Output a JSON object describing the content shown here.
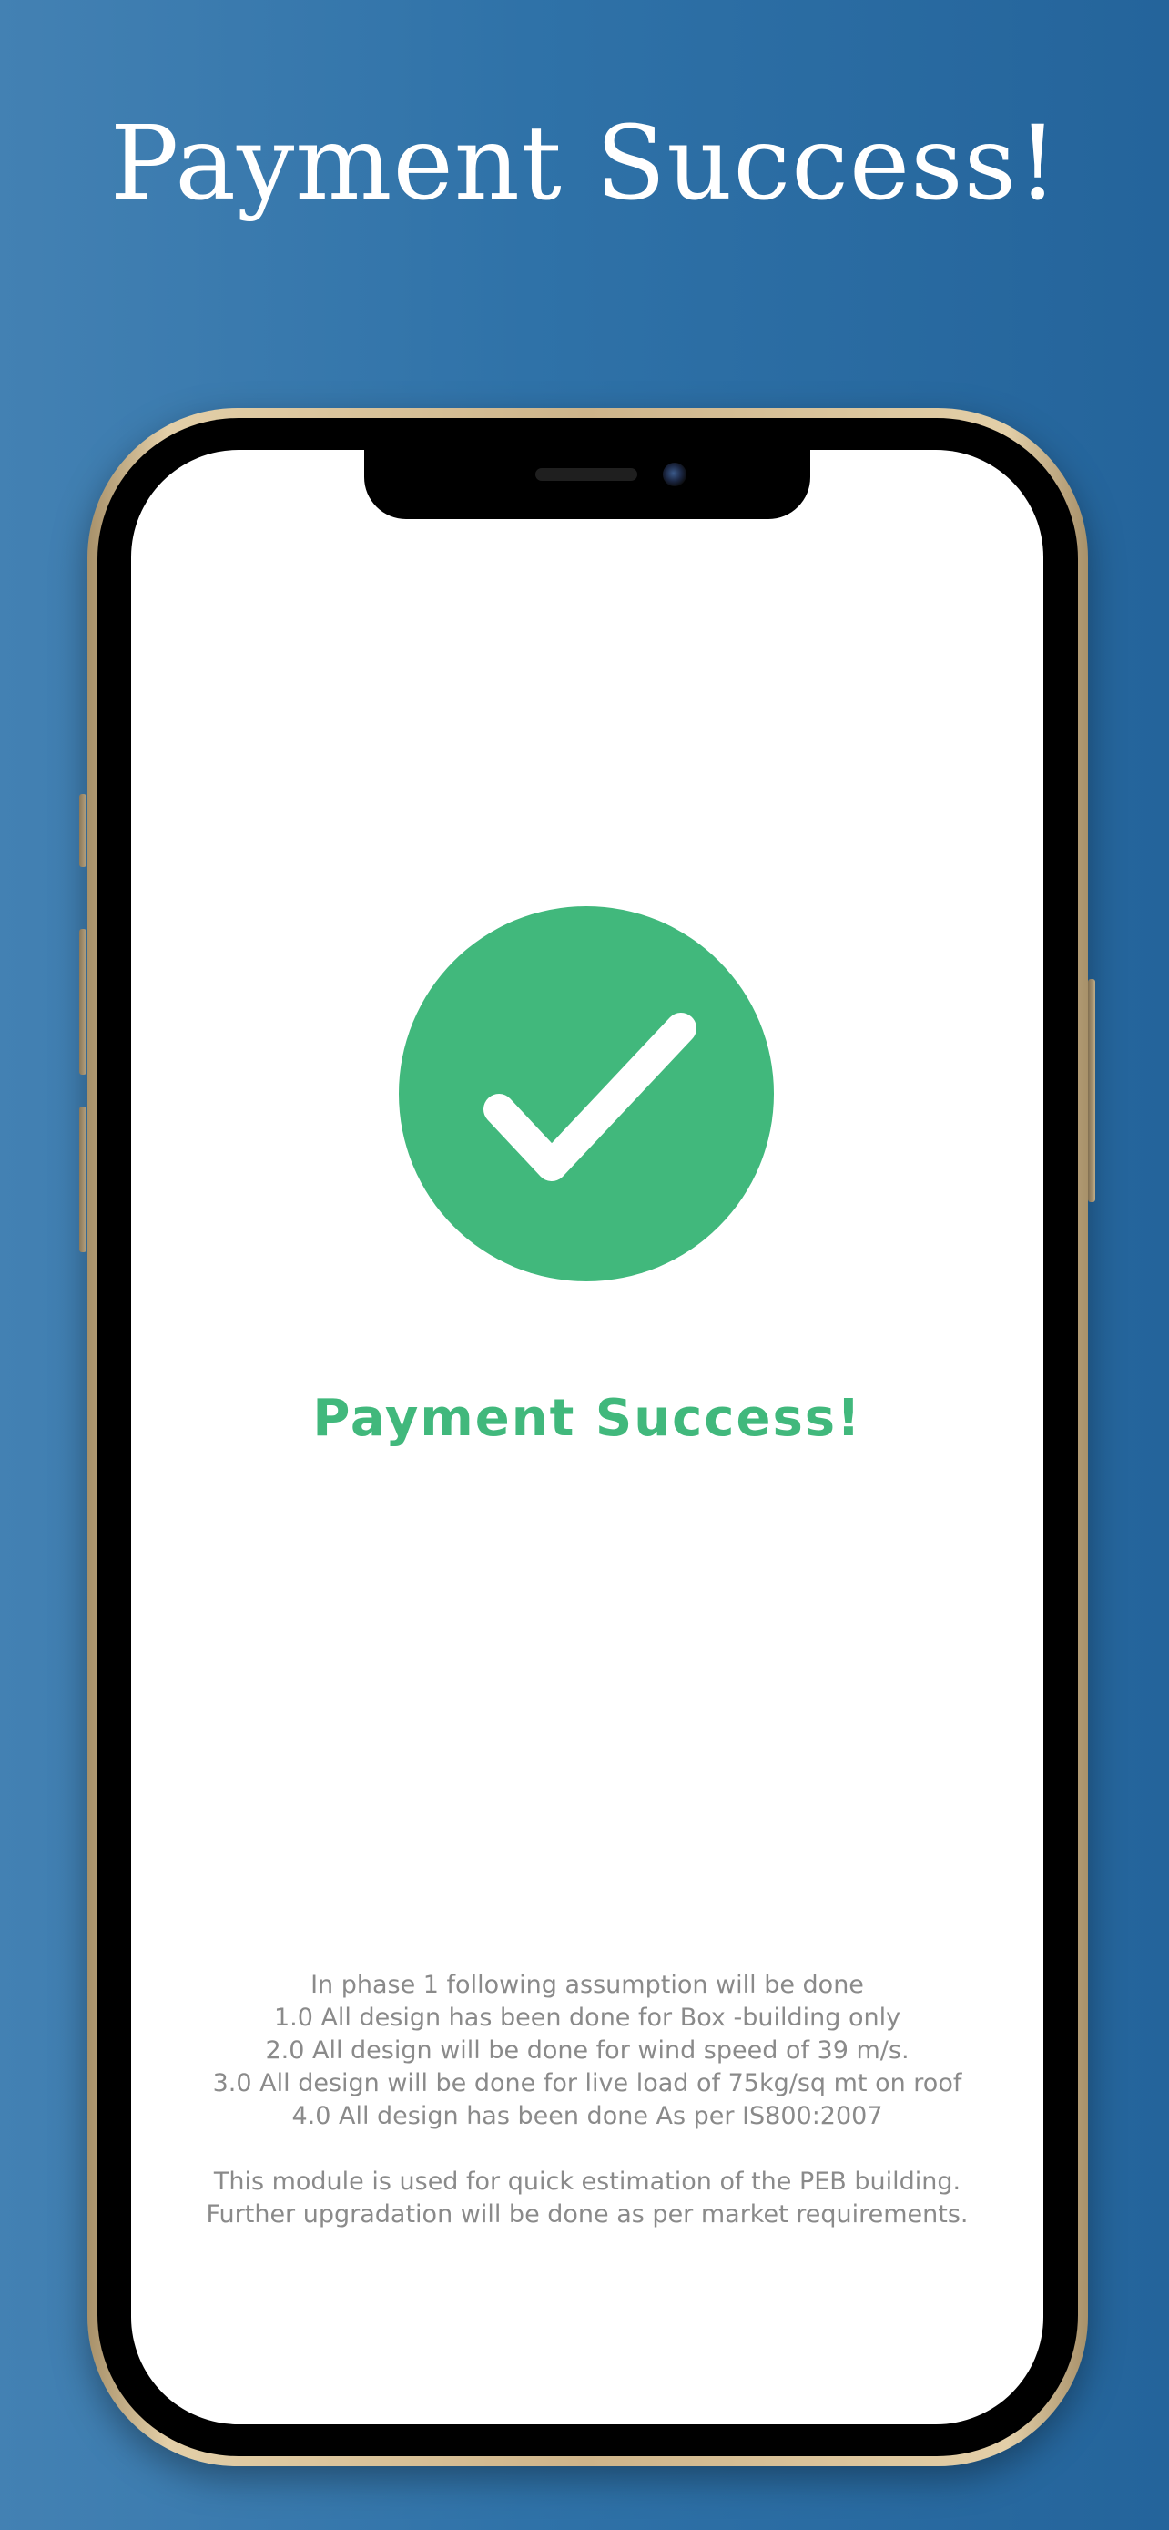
{
  "headline": "Payment Success!",
  "screen": {
    "title": "Payment Success!",
    "status_icon": "check-circle-icon",
    "assumptions": [
      "In phase 1 following assumption will be done",
      "1.0 All design has been done for Box -building only",
      "2.0 All design will be done for wind speed of 39 m/s.",
      "3.0 All design will be done for live load of 75kg/sq mt on roof",
      "4.0 All design has been done As per IS800:2007"
    ],
    "note": [
      "This module is used for quick estimation of the PEB building.",
      "Further upgradation will be done as per market requirements."
    ]
  },
  "colors": {
    "background": "#2f72a8",
    "success": "#41b87c",
    "body_text": "#8a8a8a",
    "phone_frame": "#cdb48a"
  }
}
